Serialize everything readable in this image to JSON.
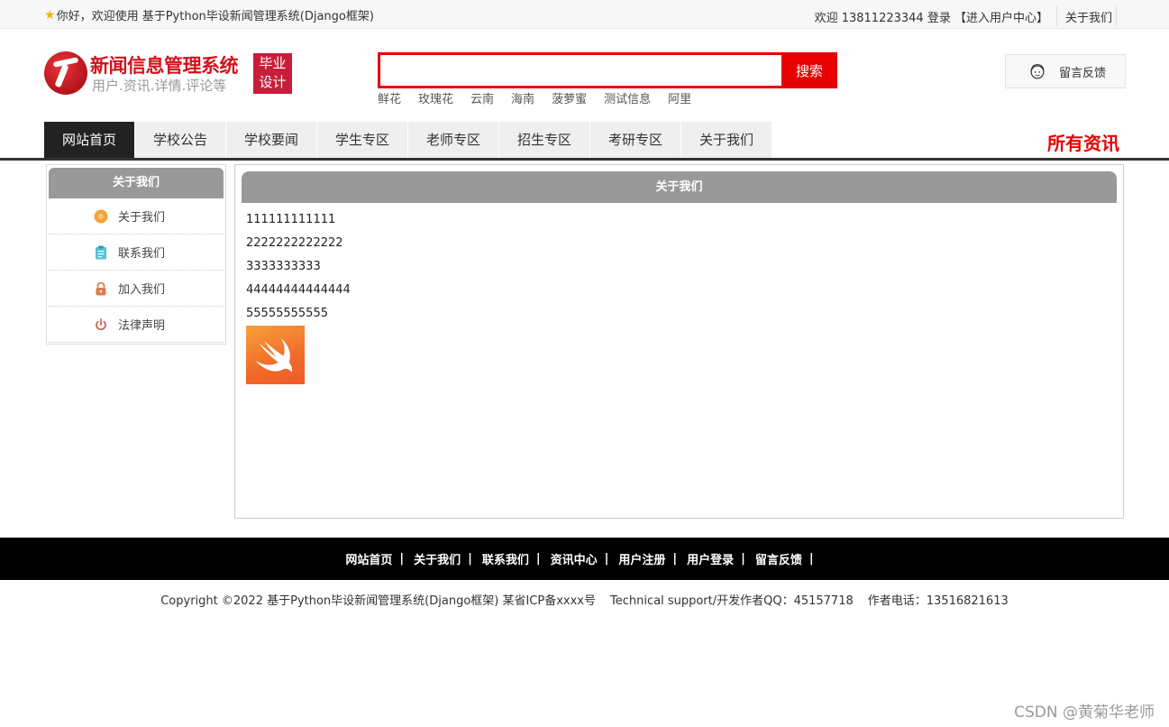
{
  "topbar": {
    "welcome": "你好，欢迎使用 基于Python毕设新闻管理系统(Django框架)",
    "user_text": "欢迎 13811223344 登录 【进入用户中心】",
    "about": "关于我们"
  },
  "header": {
    "logo_title": "新闻信息管理系统",
    "logo_sub": "用户.资讯.详情.评论等",
    "badge_line1": "毕业",
    "badge_line2": "设计",
    "search_button": "搜索",
    "search_value": "",
    "hotwords": [
      "鲜花",
      "玫瑰花",
      "云南",
      "海南",
      "菠萝蜜",
      "测试信息",
      "阿里"
    ],
    "feedback": "留言反馈"
  },
  "nav": {
    "items": [
      "网站首页",
      "学校公告",
      "学校要闻",
      "学生专区",
      "老师专区",
      "招生专区",
      "考研专区",
      "关于我们"
    ],
    "active_index": 0,
    "all_news": "所有资讯"
  },
  "sidebar": {
    "title": "关于我们",
    "items": [
      {
        "label": "关于我们",
        "icon": "circle-icon"
      },
      {
        "label": "联系我们",
        "icon": "clipboard-icon"
      },
      {
        "label": "加入我们",
        "icon": "lock-icon"
      },
      {
        "label": "法律声明",
        "icon": "power-icon"
      }
    ]
  },
  "content": {
    "title": "关于我们",
    "lines": [
      "111111111111",
      "2222222222222",
      "3333333333",
      "44444444444444",
      "55555555555"
    ],
    "image_icon": "swift-logo"
  },
  "footer": {
    "links": [
      "网站首页",
      "关于我们",
      "联系我们",
      "资讯中心",
      "用户注册",
      "用户登录",
      "留言反馈"
    ],
    "copyright": "Copyright ©2022 基于Python毕设新闻管理系统(Django框架) 某省ICP备xxxx号",
    "support": "Technical support/开发作者QQ：45157718",
    "phone": "作者电话：13516821613"
  },
  "watermark": "CSDN @黄菊华老师",
  "colors": {
    "accent_red": "#e60000",
    "nav_active": "#222222",
    "panel_head": "#999999"
  }
}
